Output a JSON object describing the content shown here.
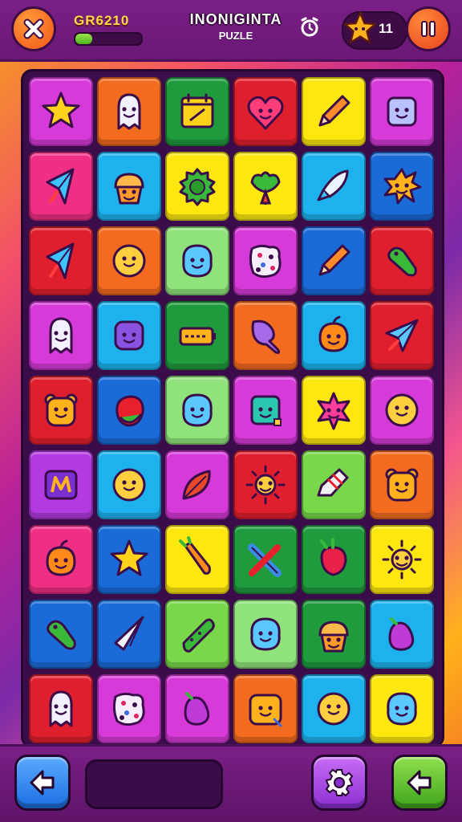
{
  "header": {
    "score_label": "GR6210",
    "progress_fraction": 0.25,
    "title": "INONIGINTA",
    "subtitle": "PUZLE",
    "stars_count": "11"
  },
  "icons": {
    "close": "close-icon",
    "pause": "pause-icon",
    "top_middle": "alarm-clock-icon",
    "star": "star-icon",
    "back": "arrow-left-icon",
    "settings": "gear-icon",
    "next": "arrow-left-icon"
  },
  "colors": {
    "magenta": "#d63ad8",
    "orange": "#f26b1e",
    "green": "#1f9a3c",
    "red": "#e01f2e",
    "yellow": "#fde70f",
    "purple": "#b23ae0",
    "pink": "#ef2e86",
    "blue": "#1a6bd8",
    "cyan": "#1db2ee",
    "lime": "#78d84a",
    "lightgreen": "#8fe37a"
  },
  "board": {
    "rows": 9,
    "cols": 6,
    "tiles": [
      [
        "magenta",
        "orange",
        "green",
        "red",
        "yellow",
        "magenta"
      ],
      [
        "pink",
        "cyan",
        "yellow",
        "yellow",
        "cyan",
        "blue"
      ],
      [
        "red",
        "orange",
        "lightgreen",
        "magenta",
        "blue",
        "red"
      ],
      [
        "magenta",
        "cyan",
        "green",
        "orange",
        "cyan",
        "red"
      ],
      [
        "red",
        "blue",
        "lightgreen",
        "magenta",
        "yellow",
        "magenta"
      ],
      [
        "purple",
        "cyan",
        "magenta",
        "red",
        "lime",
        "orange"
      ],
      [
        "pink",
        "blue",
        "yellow",
        "green",
        "green",
        "yellow"
      ],
      [
        "blue",
        "blue",
        "lime",
        "lightgreen",
        "green",
        "cyan"
      ],
      [
        "red",
        "magenta",
        "magenta",
        "orange",
        "cyan",
        "yellow"
      ]
    ],
    "icons": [
      [
        "star",
        "ghost",
        "calendar",
        "heart",
        "pencil",
        "robot-face"
      ],
      [
        "kite",
        "cupcake",
        "gear-blob",
        "frog",
        "rocket",
        "splat"
      ],
      [
        "kite",
        "smiley",
        "blob-face",
        "dice",
        "pencil",
        "pickle"
      ],
      [
        "ghost",
        "cube-face",
        "battery",
        "drumstick",
        "pumpkin",
        "plane"
      ],
      [
        "bear",
        "fruit",
        "blob-face",
        "square-face",
        "flower",
        "smiley"
      ],
      [
        "letter-m",
        "smiley",
        "leaf",
        "sun",
        "crayon",
        "bear"
      ],
      [
        "pumpkin",
        "star",
        "carrot",
        "crossed-sticks",
        "radish",
        "sun"
      ],
      [
        "pickle",
        "paper-plane",
        "cucumber",
        "blob-face",
        "cupcake",
        "eggplant"
      ],
      [
        "ghost",
        "dice",
        "eggplant",
        "monster",
        "smiley",
        "blob-face"
      ]
    ]
  }
}
